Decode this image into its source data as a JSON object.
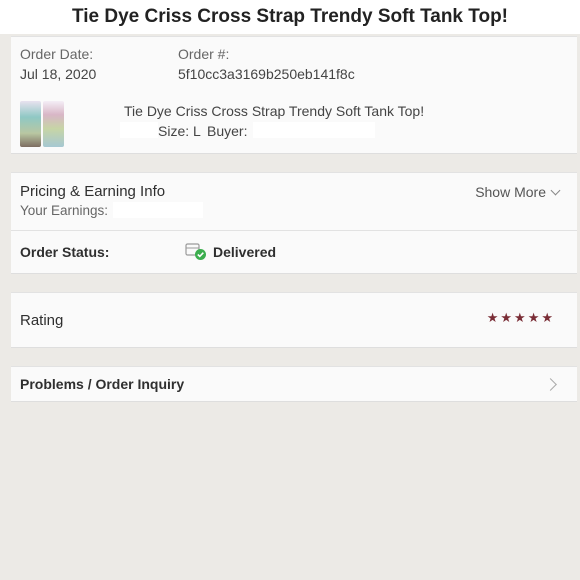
{
  "header": {
    "title": "Tie Dye Criss Cross Strap Trendy Soft Tank Top!"
  },
  "order": {
    "date_label": "Order Date:",
    "date_value": "Jul 18, 2020",
    "number_label": "Order #:",
    "number_value": "5f10cc3a3169b250eb141f8c",
    "item_title": "Tie Dye Criss Cross Strap Trendy Soft Tank Top!",
    "size_text": "Size: L",
    "buyer_label": "Buyer:"
  },
  "pricing": {
    "title": "Pricing & Earning Info",
    "earnings_label": "Your Earnings:",
    "show_more": "Show More"
  },
  "status": {
    "label": "Order Status:",
    "value": "Delivered",
    "accent": "#3cae4e"
  },
  "rating": {
    "label": "Rating",
    "stars": 5,
    "max_stars": 5,
    "color": "#7a2d36"
  },
  "problems": {
    "label": "Problems / Order Inquiry"
  }
}
